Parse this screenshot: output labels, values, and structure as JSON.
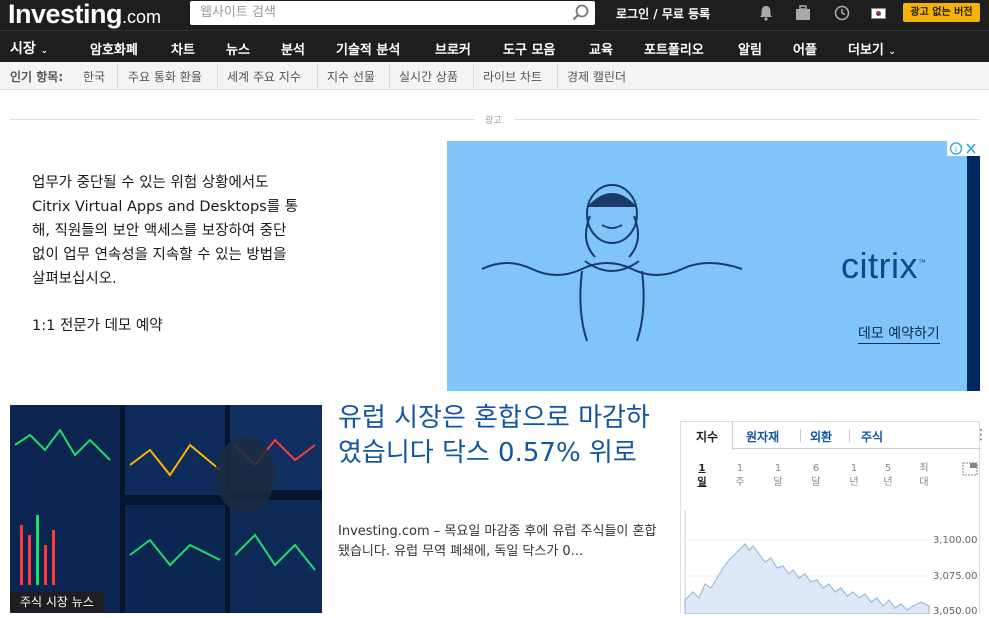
{
  "header": {
    "logo_main": "Investing",
    "logo_suffix": ".com",
    "search_placeholder": "웹사이트 검색",
    "login": "로그인 / 무료 등록",
    "ad_free": "광고 없는 버전"
  },
  "nav": {
    "market": "시장",
    "items": [
      "암호화폐",
      "차트",
      "뉴스",
      "분석",
      "기술적 분석",
      "브로커",
      "도구 모음",
      "교육",
      "포트폴리오",
      "알림",
      "어플",
      "더보기"
    ]
  },
  "subnav": {
    "label": "인기 항목:",
    "items": [
      "한국",
      "주요 통화 환율",
      "세계 주요 지수",
      "지수 선물",
      "실시간 상품",
      "라이브 차트",
      "경제 캘린더"
    ]
  },
  "ad": {
    "label": "광고",
    "body": "업무가 중단될 수 있는 위험 상황에서도 Citrix Virtual Apps and Desktops를 통해, 직원들의 보안 액세스를 보장하여 중단 없이 업무 연속성을 지속할 수 있는 방법을 살펴보십시오.",
    "cta": "1:1 전문가 데모 예약",
    "brand": "citrix",
    "brand_mark": "™",
    "banner_cta": "데모 예약하기"
  },
  "article": {
    "tag": "주식 시장 뉴스",
    "title": "유럽 시장은 혼합으로 마감하였습니다 닥스 0.57% 위로",
    "snippet": "Investing.com – 목요일 마감종 후에 유럽 주식들이 혼합됐습니다. 유럽 무역 폐쇄에, 독일 닥스가 0..."
  },
  "widget": {
    "tabs": [
      "지수",
      "원자재",
      "외환",
      "주식"
    ],
    "periods": [
      {
        "label": "1\n일",
        "active": true
      },
      {
        "label": "1\n주",
        "active": false
      },
      {
        "label": "1\n달",
        "active": false
      },
      {
        "label": "6\n달",
        "active": false
      },
      {
        "label": "1\n년",
        "active": false
      },
      {
        "label": "5\n년",
        "active": false
      },
      {
        "label": "최\n대",
        "active": false
      }
    ],
    "y_ticks": [
      "3,100.00",
      "3,075.00",
      "3,050.00"
    ]
  },
  "colors": {
    "header_bg": "#1e1e1e",
    "accent": "#f5b30a",
    "link": "#1256a0",
    "ad_bg": "#7fc5fa"
  }
}
